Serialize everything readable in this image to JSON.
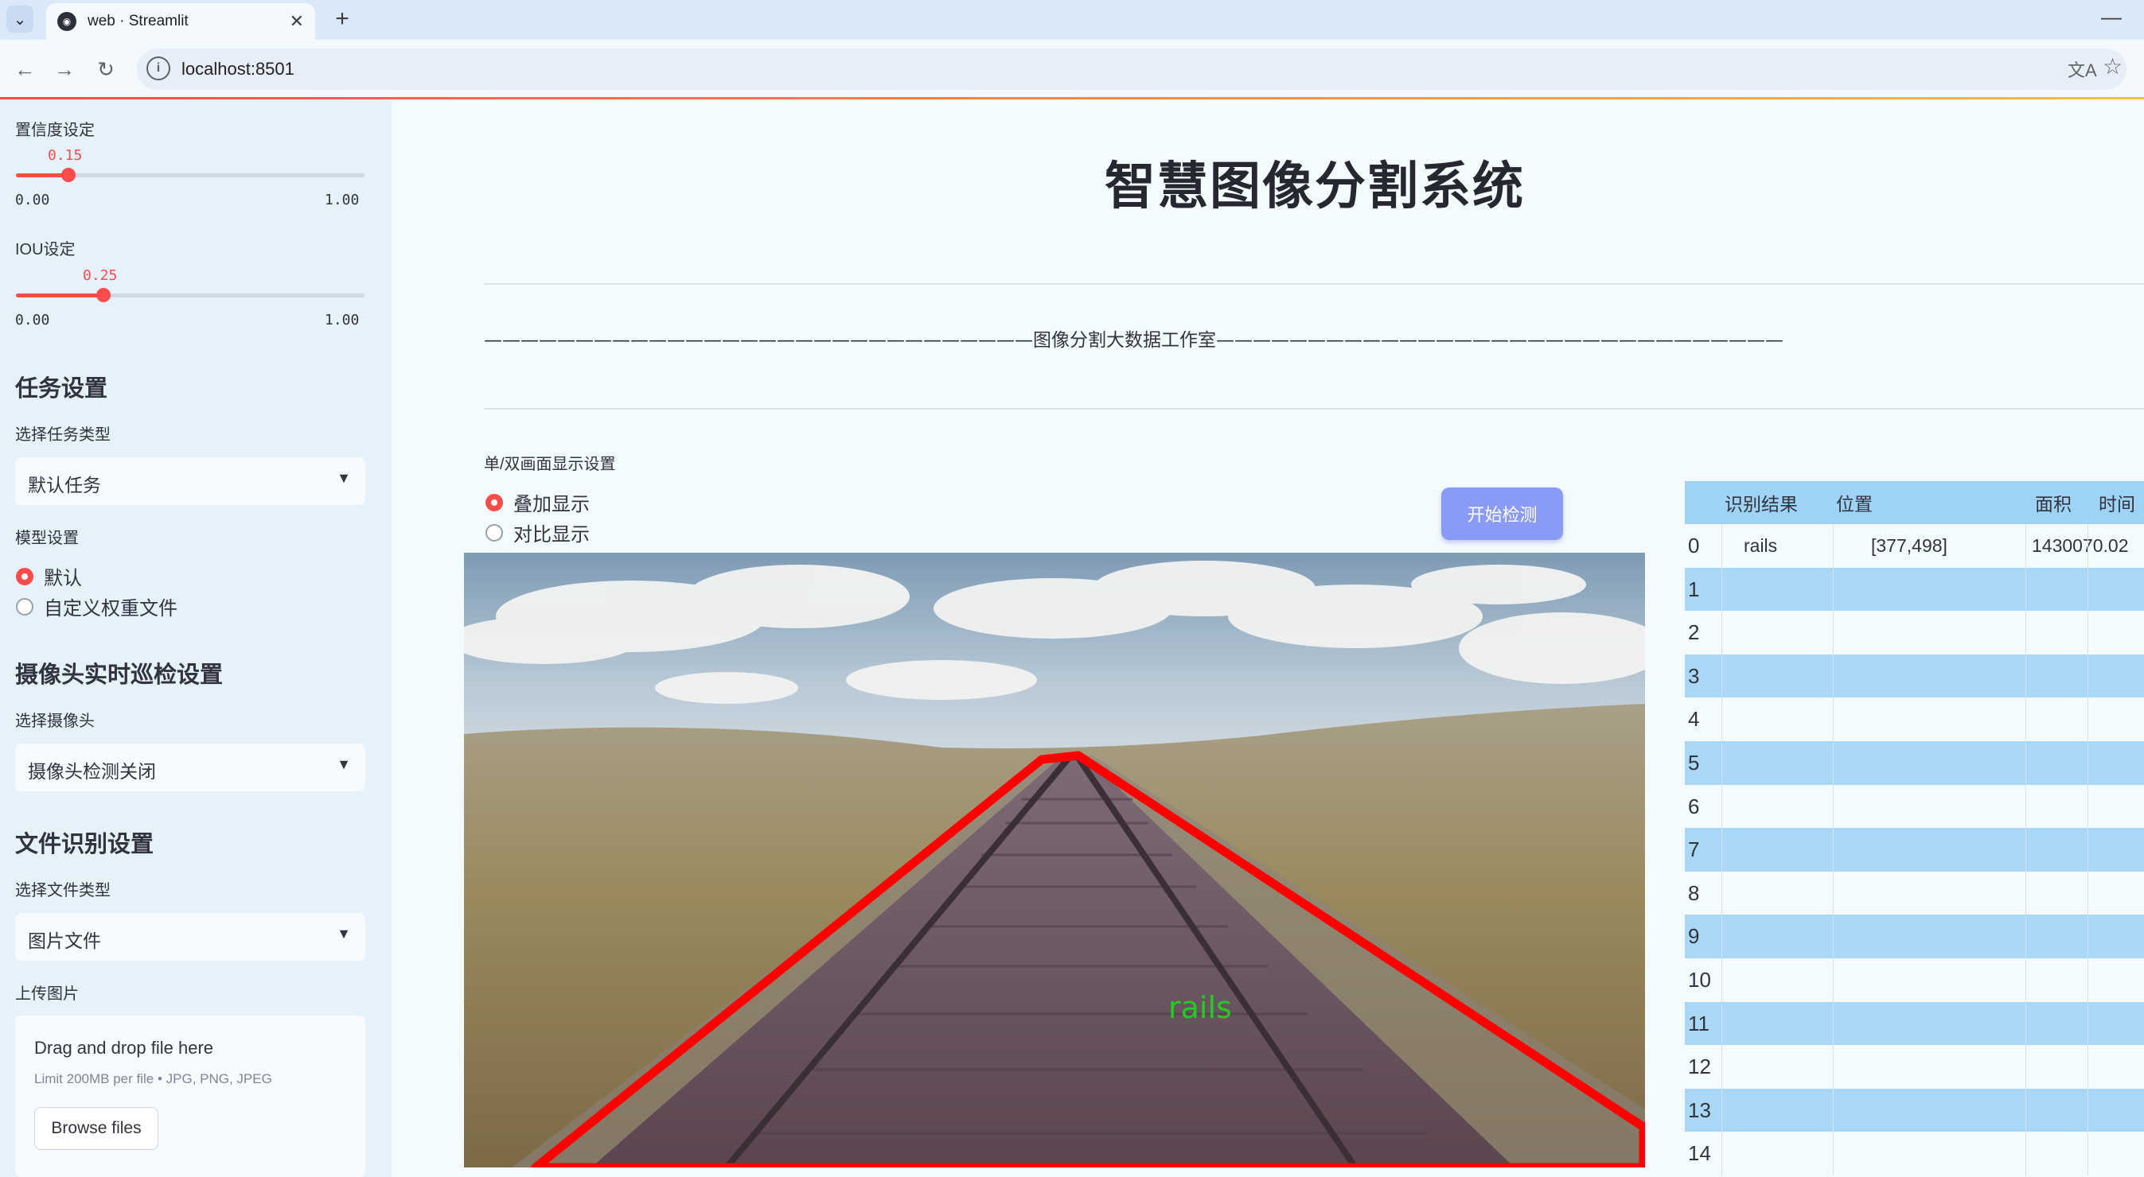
{
  "browser": {
    "tab_title": "web · Streamlit",
    "url": "localhost:8501"
  },
  "sidebar": {
    "confidence": {
      "label": "置信度设定",
      "value": "0.15",
      "min": "0.00",
      "max": "1.00",
      "fraction": 0.15
    },
    "iou": {
      "label": "IOU设定",
      "value": "0.25",
      "min": "0.00",
      "max": "1.00",
      "fraction": 0.25
    },
    "task_header": "任务设置",
    "task_type_label": "选择任务类型",
    "task_type_value": "默认任务",
    "model_label": "模型设置",
    "model_options": [
      "默认",
      "自定义权重文件"
    ],
    "model_selected": 0,
    "camera_header": "摄像头实时巡检设置",
    "camera_label": "选择摄像头",
    "camera_value": "摄像头检测关闭",
    "file_header": "文件识别设置",
    "file_type_label": "选择文件类型",
    "file_type_value": "图片文件",
    "upload_label": "上传图片",
    "upload_drag": "Drag and drop file here",
    "upload_limit": "Limit 200MB per file • JPG, PNG, JPEG",
    "upload_button": "Browse files"
  },
  "main": {
    "title": "智慧图像分割系统",
    "divider_text": "——————————————————————————————图像分割大数据工作室———————————————————————————————",
    "display_label": "单/双画面显示设置",
    "display_options": [
      "叠加显示",
      "对比显示"
    ],
    "display_selected": 0,
    "start_button": "开始检测",
    "detection_label": "rails"
  },
  "table": {
    "columns": [
      "识别结果",
      "位置",
      "面积",
      "时间"
    ],
    "rows": [
      {
        "index": "0",
        "result": "rails",
        "position": "[377,498]",
        "area": "1430070.02"
      },
      {
        "index": "1"
      },
      {
        "index": "2"
      },
      {
        "index": "3"
      },
      {
        "index": "4"
      },
      {
        "index": "5"
      },
      {
        "index": "6"
      },
      {
        "index": "7"
      },
      {
        "index": "8"
      },
      {
        "index": "9"
      },
      {
        "index": "10"
      },
      {
        "index": "11"
      },
      {
        "index": "12"
      },
      {
        "index": "13"
      },
      {
        "index": "14"
      }
    ]
  },
  "colors": {
    "accent": "#ff4b4b",
    "button": "#8a9bf7",
    "table_header": "#9fd3f5",
    "detection_box": "#ff0000",
    "detection_text": "#22cc22"
  }
}
